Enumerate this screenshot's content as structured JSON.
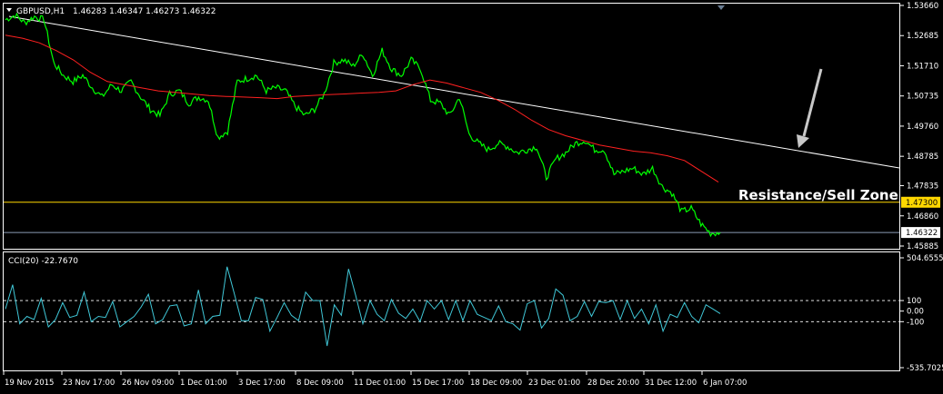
{
  "header": {
    "symbol": "GBPUSD,H1",
    "ohlc": "1.46283 1.46347 1.46273 1.46322"
  },
  "annotation": "Resistance/Sell Zone",
  "colors": {
    "price": "#00ff00",
    "ma": "#ff2020",
    "trendline": "#ffffff",
    "resistance": "#ffd700",
    "current_price_line": "#8a9bb5",
    "cci": "#40c8d8",
    "arrow": "#c8c8c8",
    "grid_frame": "#ffffff"
  },
  "chart_data": [
    {
      "type": "line",
      "ylim": [
        1.45885,
        1.5366
      ],
      "y_ticks": [
        "1.53660",
        "1.52685",
        "1.51710",
        "1.50735",
        "1.49760",
        "1.48785",
        "1.47835",
        "1.46860",
        "1.45885"
      ],
      "x_ticks": [
        "19 Nov 2015",
        "23 Nov 17:00",
        "26 Nov 09:00",
        "1 Dec 01:00",
        "3 Dec 17:00",
        "8 Dec 09:00",
        "11 Dec 01:00",
        "15 Dec 17:00",
        "18 Dec 09:00",
        "23 Dec 01:00",
        "28 Dec 20:00",
        "31 Dec 12:00",
        "6 Jan 07:00"
      ],
      "price_labels": {
        "resistance": "1.47300",
        "current": "1.46322"
      },
      "levels": {
        "resistance": 1.473,
        "current": 1.46322
      },
      "series": [
        {
          "values": [
            1.532,
            1.5335,
            1.531,
            1.533,
            1.532,
            1.518,
            1.514,
            1.512,
            1.514,
            1.51,
            1.507,
            1.511,
            1.509,
            1.512,
            1.507,
            1.503,
            1.501,
            1.508,
            1.509,
            1.505,
            1.507,
            1.506,
            1.494,
            1.496,
            1.512,
            1.513,
            1.514,
            1.509,
            1.51,
            1.509,
            1.504,
            1.501,
            1.503,
            1.508,
            1.518,
            1.519,
            1.517,
            1.521,
            1.514,
            1.522,
            1.516,
            1.514,
            1.519,
            1.516,
            1.506,
            1.505,
            1.501,
            1.507,
            1.495,
            1.492,
            1.49,
            1.492,
            1.491,
            1.489,
            1.49,
            1.491,
            1.481,
            1.487,
            1.489,
            1.492,
            1.493,
            1.49,
            1.49,
            1.482,
            1.483,
            1.484,
            1.482,
            1.484,
            1.478,
            1.476,
            1.47,
            1.471,
            1.466,
            1.463,
            1.4632
          ]
        },
        {
          "values": [
            1.527,
            1.526,
            1.5245,
            1.522,
            1.519,
            1.515,
            1.512,
            1.511,
            1.51,
            1.509,
            1.5085,
            1.508,
            1.5075,
            1.5072,
            1.507,
            1.5068,
            1.5065,
            1.5072,
            1.5075,
            1.5078,
            1.508,
            1.5083,
            1.5085,
            1.509,
            1.511,
            1.5125,
            1.5115,
            1.51,
            1.5085,
            1.506,
            1.503,
            1.4995,
            1.4965,
            1.4945,
            1.493,
            1.4915,
            1.4905,
            1.4895,
            1.489,
            1.488,
            1.4865,
            1.483,
            1.4795
          ]
        }
      ]
    },
    {
      "type": "line",
      "title": "CCI(20) -22.7670",
      "ylim": [
        -535.7025,
        504.6555
      ],
      "y_ticks": [
        "504.6555",
        "100",
        "0.00",
        "-100",
        "-535.7025"
      ],
      "levels": [
        100,
        -100
      ],
      "series": [
        {
          "values": [
            20,
            250,
            -120,
            -50,
            -80,
            120,
            -150,
            -80,
            80,
            -60,
            -40,
            180,
            -100,
            -50,
            -60,
            90,
            -150,
            -100,
            -50,
            40,
            160,
            -120,
            -80,
            50,
            60,
            -140,
            -120,
            200,
            -120,
            -50,
            -40,
            420,
            170,
            -90,
            -90,
            130,
            110,
            -190,
            -60,
            80,
            -40,
            -90,
            180,
            100,
            100,
            -330,
            60,
            -40,
            400,
            150,
            -120,
            100,
            -30,
            -90,
            110,
            -20,
            -70,
            20,
            -100,
            100,
            20,
            100,
            -80,
            100,
            -90,
            100,
            -30,
            -60,
            -90,
            50,
            -100,
            -120,
            -180,
            70,
            100,
            -160,
            -70,
            210,
            150,
            -90,
            -50,
            90,
            -50,
            90,
            80,
            100,
            -80,
            100,
            -70,
            20,
            -120,
            60,
            -190,
            -30,
            -60,
            80,
            -50,
            -110,
            60,
            20,
            -23
          ]
        }
      ]
    }
  ]
}
